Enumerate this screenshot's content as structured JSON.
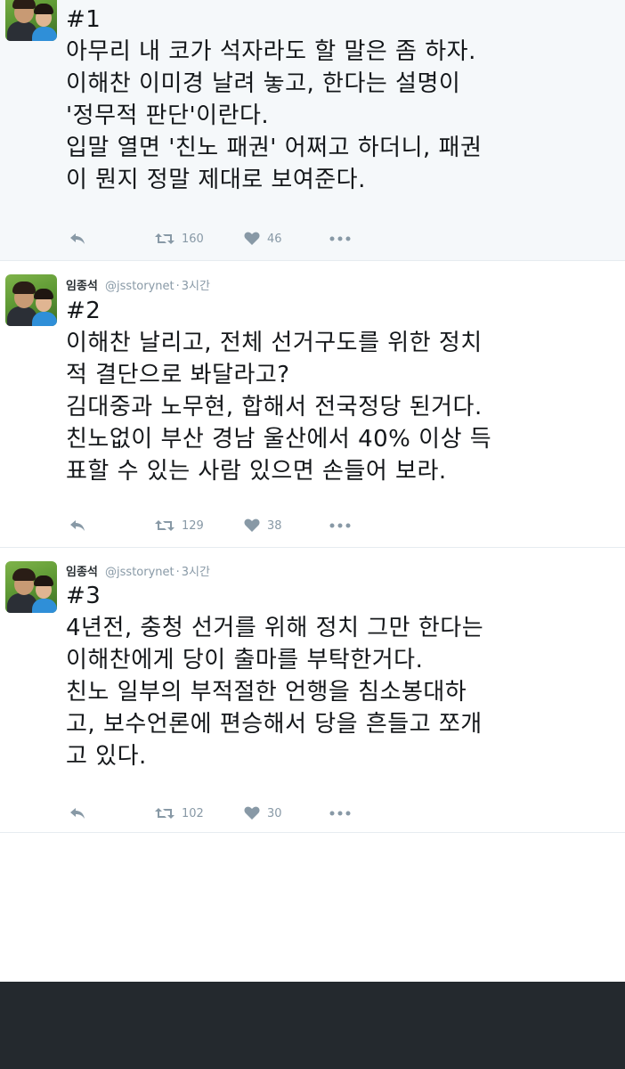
{
  "tweets": [
    {
      "header": {
        "name": "",
        "handle": "",
        "time": ""
      },
      "number": "#1",
      "lines": [
        "아무리 내 코가 석자라도 할 말은 좀 하자.",
        "이해찬 이미경 날려 놓고, 한다는 설명이",
        "'정무적 판단'이란다.",
        "입말 열면 '친노 패권' 어쩌고 하더니, 패권",
        "이 뭔지 정말 제대로 보여준다."
      ],
      "retweets": "160",
      "likes": "46"
    },
    {
      "header": {
        "name": "임종석",
        "handle": "@jsstorynet",
        "time": "3시간"
      },
      "number": "#2",
      "lines": [
        "이해찬 날리고, 전체 선거구도를 위한 정치",
        "적 결단으로 봐달라고?",
        "김대중과 노무현, 합해서 전국정당 된거다.",
        "친노없이 부산 경남 울산에서 40% 이상 득",
        "표할 수 있는 사람 있으면 손들어 보라."
      ],
      "retweets": "129",
      "likes": "38"
    },
    {
      "header": {
        "name": "임종석",
        "handle": "@jsstorynet",
        "time": "3시간"
      },
      "number": "#3",
      "lines": [
        "4년전, 충청 선거를 위해 정치 그만 한다는",
        "이해찬에게 당이 출마를 부탁한거다.",
        "친노 일부의 부적절한 언행을 침소봉대하",
        "고, 보수언론에 편승해서 당을 흔들고 쪼개",
        "고 있다."
      ],
      "retweets": "102",
      "likes": "30"
    }
  ],
  "icons": {
    "reply": "reply-icon",
    "retweet": "retweet-icon",
    "like": "heart-icon",
    "more": "more-icon"
  },
  "colors": {
    "text": "#14171a",
    "muted": "#8899a6",
    "retweet_icon": "#8899a6",
    "highlight_bg": "#f5f8fa",
    "footer": "#24292e"
  }
}
